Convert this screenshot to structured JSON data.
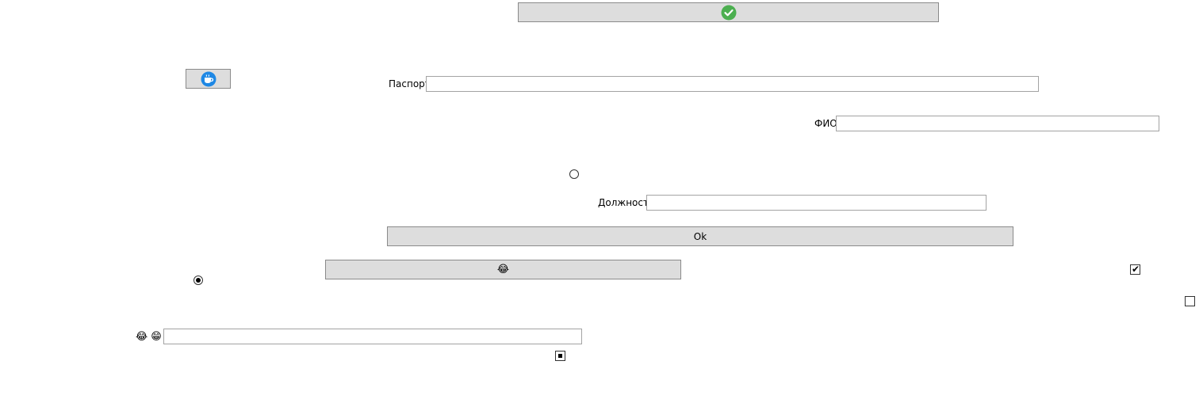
{
  "buttons": {
    "top_icon": "check-circle-icon",
    "small_icon": "cup-icon",
    "ok_label": "Ok",
    "emoji_button_glyph": "😂"
  },
  "fields": {
    "passport_label": "Паспорт",
    "passport_value": "",
    "fio_label": "ФИО",
    "fio_value": "",
    "position_label": "Должность",
    "position_value": "",
    "emoji_field_value": ""
  },
  "emoji_label": {
    "first": "😂",
    "second": "😁"
  },
  "checkboxes": {
    "right_top_checked": true,
    "right_bottom_checked": false,
    "bottom_indeterminate": true
  },
  "radios": {
    "upper_selected": false,
    "left_selected": true
  },
  "colors": {
    "button_bg": "#dddddd",
    "button_border": "#8a8a8a",
    "field_border": "#a3a3a3",
    "check_green": "#4caf50",
    "cup_blue": "#1e88e5"
  }
}
